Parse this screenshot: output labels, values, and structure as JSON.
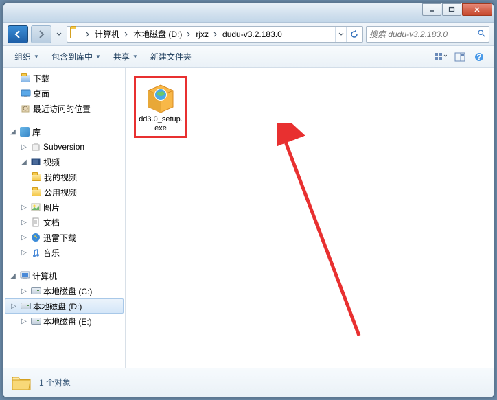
{
  "titlebar": {
    "minimize": "–",
    "maximize": "□",
    "close": "×"
  },
  "nav": {
    "breadcrumbs": [
      "计算机",
      "本地磁盘 (D:)",
      "rjxz",
      "dudu-v3.2.183.0"
    ]
  },
  "search": {
    "placeholder": "搜索 dudu-v3.2.183.0"
  },
  "toolbar": {
    "organize": "组织",
    "include": "包含到库中",
    "share": "共享",
    "newfolder": "新建文件夹"
  },
  "sidebar": {
    "favorites": {
      "downloads": "下载",
      "desktop": "桌面",
      "recent": "最近访问的位置"
    },
    "libraries": {
      "label": "库",
      "subversion": "Subversion",
      "videos": "视频",
      "my_videos": "我的视频",
      "public_videos": "公用视频",
      "pictures": "图片",
      "documents": "文档",
      "xunlei": "迅雷下载",
      "music": "音乐"
    },
    "computer": {
      "label": "计算机",
      "drive_c": "本地磁盘 (C:)",
      "drive_d": "本地磁盘 (D:)",
      "drive_e": "本地磁盘 (E:)"
    }
  },
  "content": {
    "file1": "dd3.0_setup.exe"
  },
  "statusbar": {
    "count": "1 个对象"
  }
}
